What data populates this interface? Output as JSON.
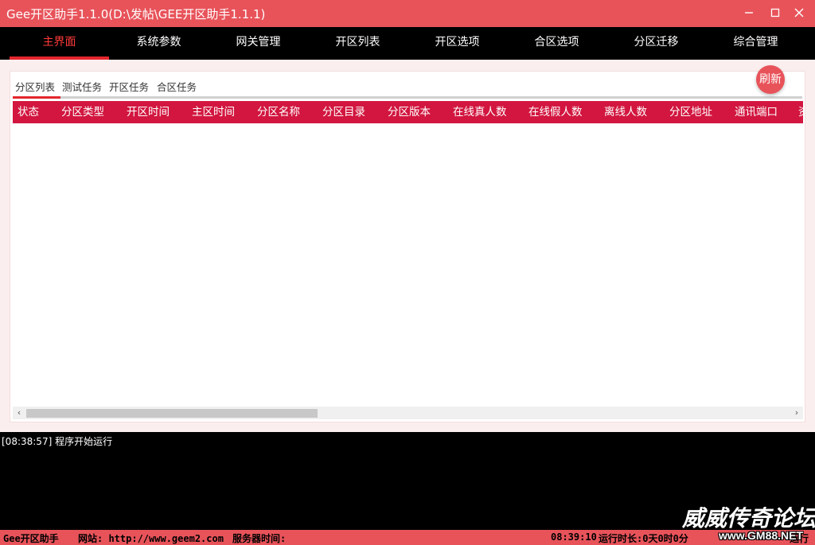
{
  "window": {
    "title": "Gee开区助手1.1.0(D:\\发帖\\GEE开区助手1.1.1)"
  },
  "nav": {
    "items": [
      "主界面",
      "系统参数",
      "网关管理",
      "开区列表",
      "开区选项",
      "合区选项",
      "分区迁移",
      "综合管理"
    ],
    "active_index": 0
  },
  "subtabs": {
    "items": [
      "分区列表",
      "测试任务",
      "开区任务",
      "合区任务"
    ],
    "active_index": 0
  },
  "refresh_label": "刷新",
  "grid": {
    "columns": [
      "状态",
      "分区类型",
      "开区时间",
      "主区时间",
      "分区名称",
      "分区目录",
      "分区版本",
      "在线真人数",
      "在线假人数",
      "离线人数",
      "分区地址",
      "通讯端口",
      "资"
    ],
    "rows": []
  },
  "log": {
    "lines": [
      "[08:38:57] 程序开始运行"
    ]
  },
  "statusbar": {
    "app_name": "Gee开区助手",
    "website": "网站: http://www.geem2.com",
    "server_time_label": "服务器时间:",
    "clock": "08:39:10",
    "uptime": "运行时长:0天0时0分",
    "state_suffix": "运行"
  },
  "watermark": {
    "main": "威威传奇论坛",
    "sub": "www.GM88.NET"
  },
  "colors": {
    "titlebar": "#e8535a",
    "nav_bg": "#000000",
    "accent": "#e3262c",
    "grid_header": "#d2163f"
  }
}
